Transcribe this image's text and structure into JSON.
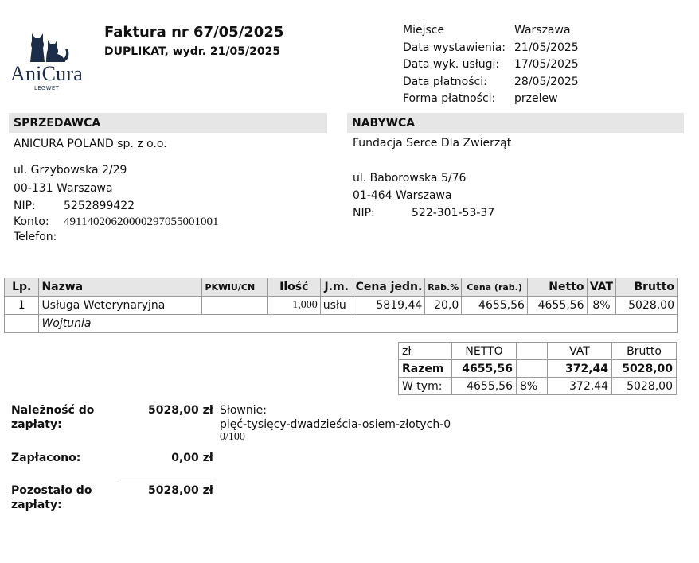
{
  "logo": {
    "brand": "AniCura",
    "sub": "LEGWET"
  },
  "header": {
    "title": "Faktura nr  67/05/2025",
    "subtitle": "DUPLIKAT, wydr. 21/05/2025"
  },
  "meta": [
    {
      "label": "Miejsce",
      "value": "Warszawa"
    },
    {
      "label": "Data wystawienia:",
      "value": "21/05/2025"
    },
    {
      "label": "Data wyk. usługi:",
      "value": "17/05/2025"
    },
    {
      "label": "Data płatności:",
      "value": "28/05/2025"
    },
    {
      "label": "Forma płatności:",
      "value": "przelew"
    }
  ],
  "seller": {
    "heading": "SPRZEDAWCA",
    "name": "ANICURA POLAND sp. z o.o.",
    "street": "ul. Grzybowska 2/29",
    "city": "00-131 Warszawa",
    "nip_label": "NIP:",
    "nip": "5252899422",
    "konto_label": "Konto:",
    "konto": "49114020620000297055001001",
    "telefon_label": "Telefon:"
  },
  "buyer": {
    "heading": "NABYWCA",
    "name": "Fundacja Serce Dla Zwierząt",
    "street": "ul. Baborowska 5/76",
    "city": "01-464 Warszawa",
    "nip_label": "NIP:",
    "nip": "522-301-53-37"
  },
  "items": {
    "headers": {
      "lp": "Lp.",
      "nazwa": "Nazwa",
      "pkwiu": "PKWiU/CN",
      "ilosc": "Ilość",
      "jm": "J.m.",
      "cena": "Cena jedn.",
      "rab": "Rab.%",
      "cena_rab": "Cena (rab.)",
      "netto": "Netto",
      "vat": "VAT",
      "brutto": "Brutto"
    },
    "rows": [
      {
        "lp": "1",
        "nazwa": "Usługa Weterynaryjna",
        "pkwiu": "",
        "ilosc": "1,000",
        "jm": "usłu",
        "cena": "5819,44",
        "rab": "20,0",
        "cena_rab": "4655,56",
        "netto": "4655,56",
        "vat": "8%",
        "brutto": "5028,00",
        "note": "Wojtunia"
      }
    ]
  },
  "summary": {
    "head": {
      "currency": "zł",
      "netto": "NETTO",
      "vat": "VAT",
      "brutto": "Brutto"
    },
    "total": {
      "label": "Razem",
      "netto": "4655,56",
      "vat": "372,44",
      "brutto": "5028,00"
    },
    "breakdown": {
      "label": "W tym:",
      "netto": "4655,56",
      "rate": "8%",
      "vat": "372,44",
      "brutto": "5028,00"
    }
  },
  "payment": {
    "due_label_1": "Należność do",
    "due_label_2": "zapłaty:",
    "due_value": "5028,00 zł",
    "words_label": "Słownie:",
    "words_1": "pięć-tysięcy-dwadzieścia-osiem-złotych-0",
    "words_2": "0/100",
    "paid_label": "Zapłacono:",
    "paid_value": "0,00 zł",
    "left_label_1": "Pozostało do",
    "left_label_2": "zapłaty:",
    "left_value": "5028,00 zł"
  },
  "colors": {
    "brand": "#1c2d4a",
    "header_bg": "#e6e6e6",
    "border": "#9a9a9a"
  },
  "icons": {
    "logo": "cat-and-dog-silhouette-icon"
  }
}
